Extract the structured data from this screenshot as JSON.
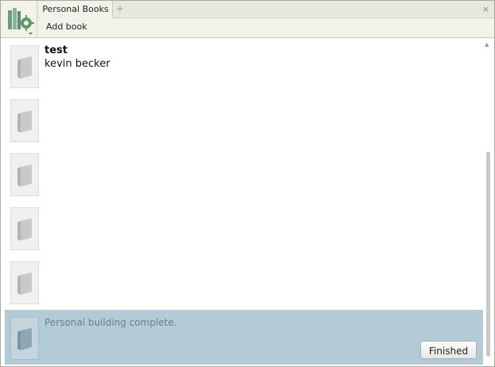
{
  "tabs": {
    "active_label": "Personal Books",
    "add_symbol": "+",
    "close_symbol": "×"
  },
  "toolbar": {
    "add_book_label": "Add book"
  },
  "books": [
    {
      "title": "test",
      "author": "kevin becker"
    },
    {
      "title": "",
      "author": ""
    },
    {
      "title": "",
      "author": ""
    },
    {
      "title": "",
      "author": ""
    },
    {
      "title": "",
      "author": ""
    }
  ],
  "status": {
    "message": "Personal building complete.",
    "finished_label": "Finished"
  },
  "icons": {
    "app": "bookshelf-gear-icon",
    "book": "book-placeholder-icon"
  },
  "colors": {
    "status_background": "#b3cbd7",
    "header_background": "#f3f2ea"
  }
}
